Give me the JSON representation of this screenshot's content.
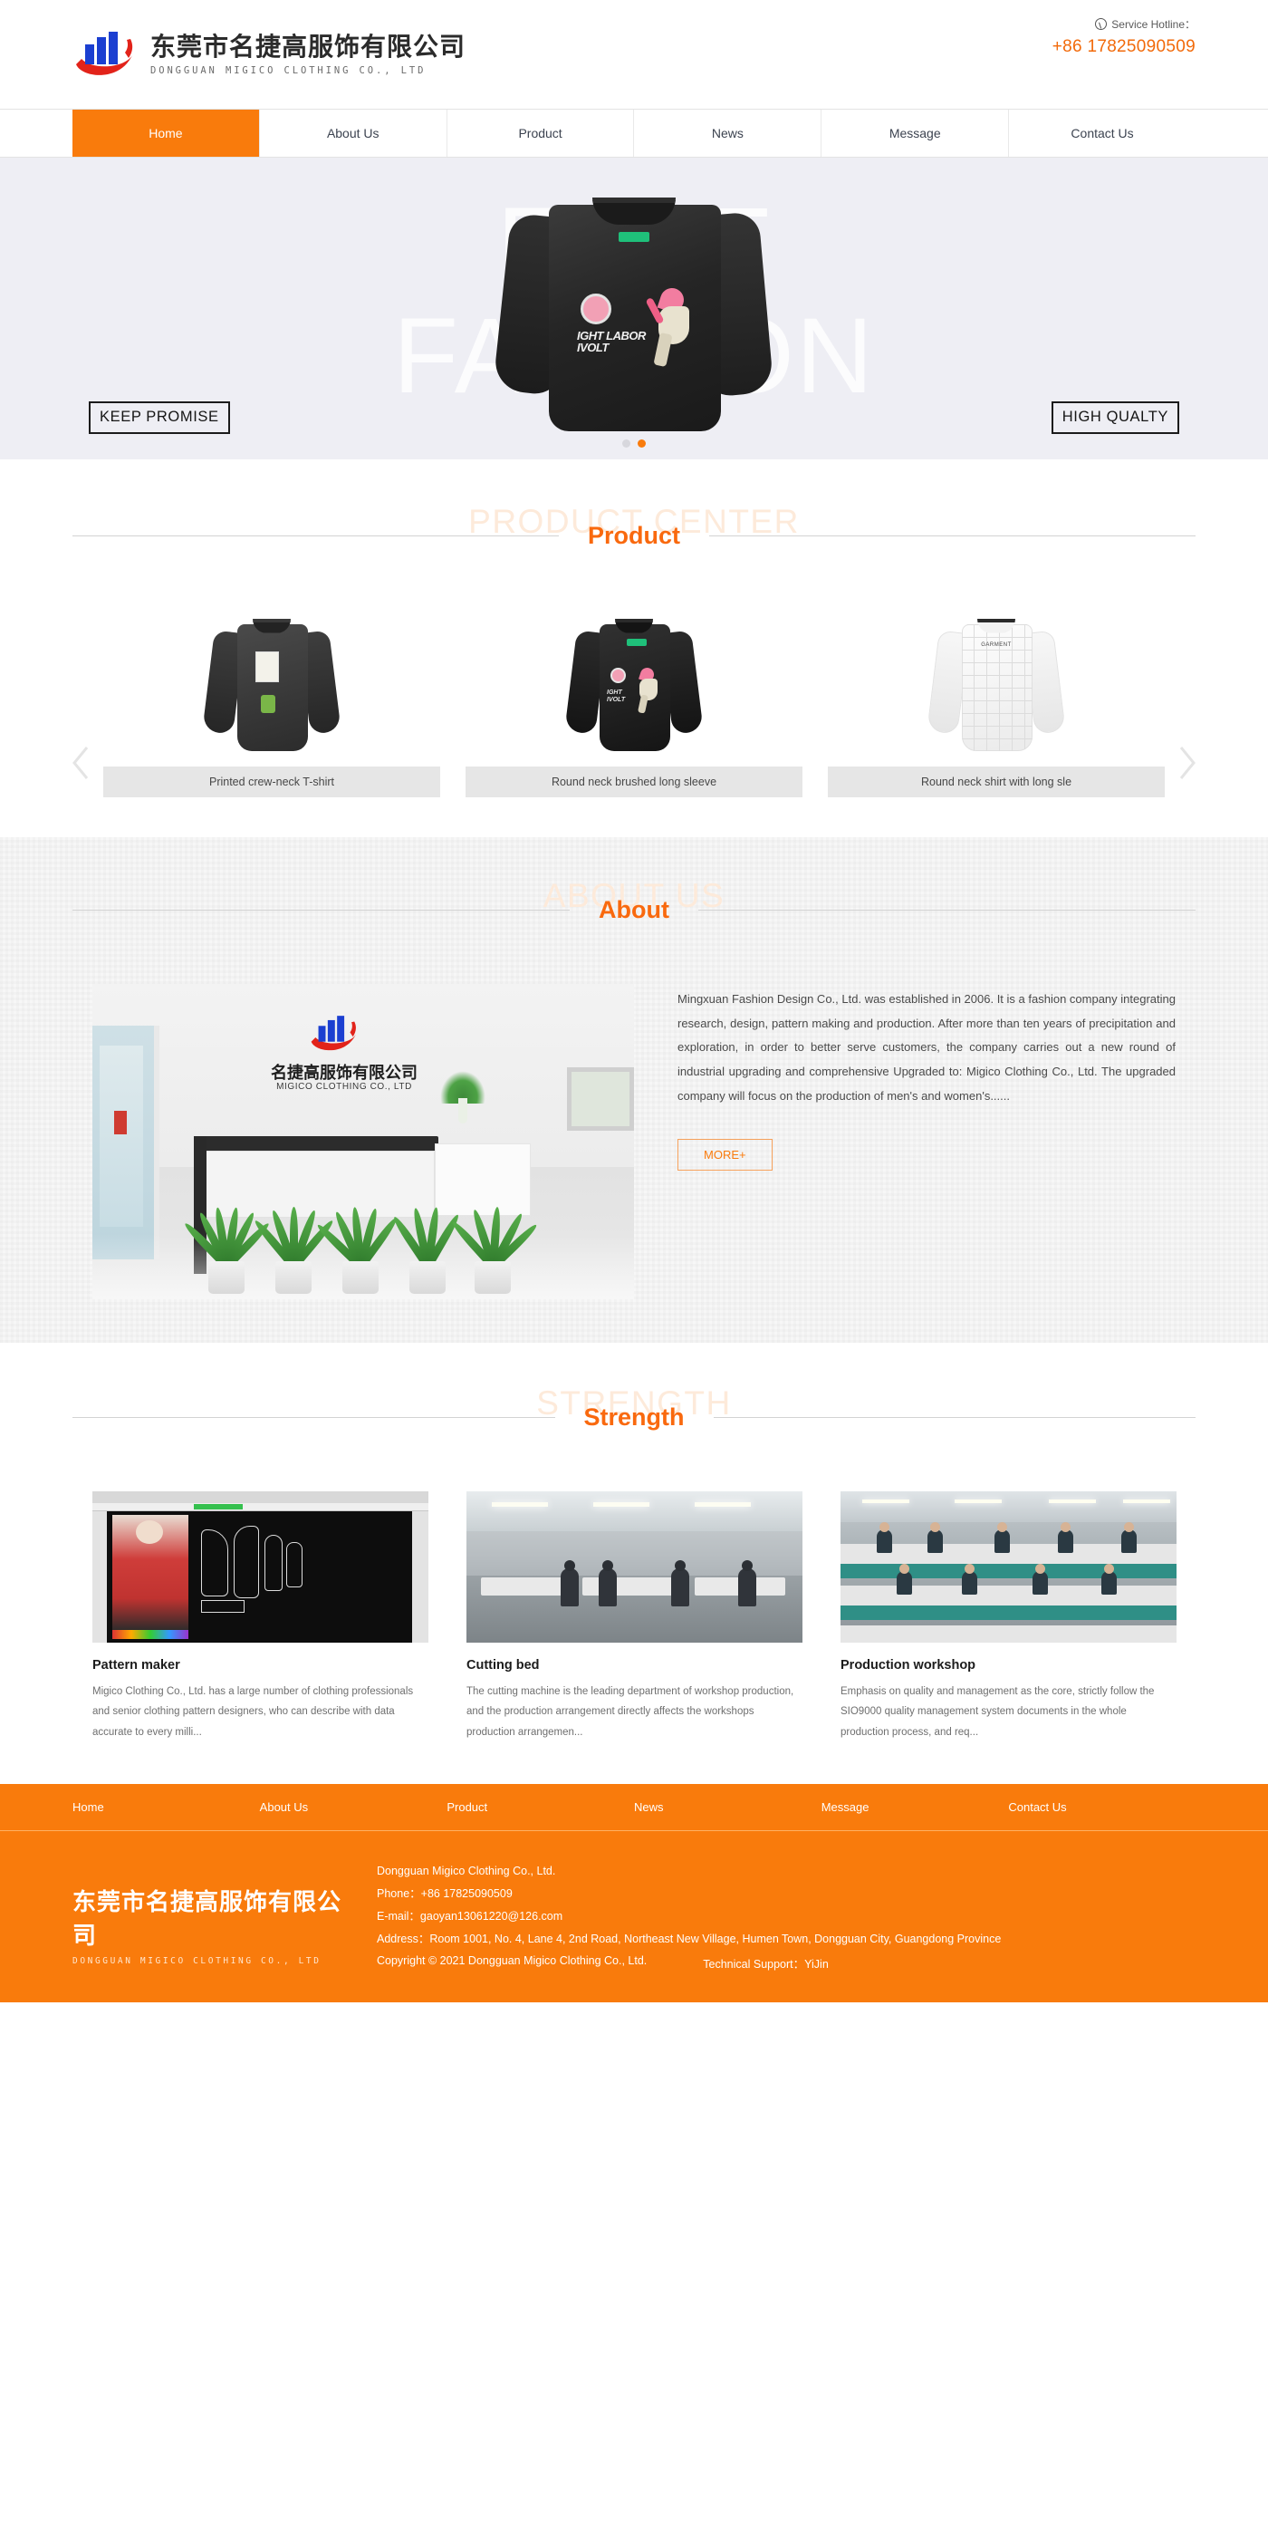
{
  "header": {
    "logo_cn": "东莞市名捷高服饰有限公司",
    "logo_en": "DONGGUAN MIGICO CLOTHING CO., LTD",
    "hotline_label": "Service Hotline：",
    "hotline_number": "+86 17825090509"
  },
  "nav": {
    "items": [
      {
        "label": "Home",
        "active": true
      },
      {
        "label": "About Us",
        "active": false
      },
      {
        "label": "Product",
        "active": false
      },
      {
        "label": "News",
        "active": false
      },
      {
        "label": "Message",
        "active": false
      },
      {
        "label": "Contact Us",
        "active": false
      }
    ]
  },
  "hero": {
    "word_top": "FAST",
    "word_bottom": "FASHION",
    "badge_left": "KEEP PROMISE",
    "badge_right": "HIGH QUALTY",
    "dots": 2,
    "active_dot": 1,
    "accent": "#f97b0c"
  },
  "product_section": {
    "ghost_title": "PRODUCT CENTER",
    "title": "Product",
    "prev_label": "‹",
    "next_label": "›",
    "items": [
      {
        "caption": "Printed crew-neck T-shirt"
      },
      {
        "caption": "Round neck brushed long sleeve"
      },
      {
        "caption": "Round neck shirt with long sle"
      }
    ]
  },
  "about_section": {
    "ghost_title": "ABOUT US",
    "title": "About",
    "photo_logo_cn": "名捷高服饰有限公司",
    "photo_logo_en": "MIGICO CLOTHING CO., LTD",
    "paragraph": "Mingxuan Fashion Design Co., Ltd. was established in 2006. It is a fashion company integrating research, design, pattern making and production. After more than ten years of precipitation and exploration, in order to better serve customers, the company carries out a new round of industrial upgrading and comprehensive Upgraded to: Migico Clothing Co., Ltd. The upgraded company will focus on the production of men's and women's......",
    "more_label": "MORE+"
  },
  "strength_section": {
    "ghost_title": "STRENGTH",
    "title": "Strength",
    "cards": [
      {
        "title": "Pattern maker",
        "desc": "Migico Clothing Co., Ltd. has a large number of clothing professionals and senior clothing pattern designers, who can describe with data accurate to every milli..."
      },
      {
        "title": "Cutting bed",
        "desc": "The cutting machine is the leading department of workshop production, and the production arrangement directly affects the workshops production arrangemen..."
      },
      {
        "title": "Production workshop",
        "desc": "Emphasis on quality and management as the core, strictly follow the SIO9000 quality management system documents in the whole production process, and req..."
      }
    ]
  },
  "footer": {
    "nav_items": [
      {
        "label": "Home"
      },
      {
        "label": "About Us"
      },
      {
        "label": "Product"
      },
      {
        "label": "News"
      },
      {
        "label": "Message"
      },
      {
        "label": "Contact Us"
      }
    ],
    "brand_cn": "东莞市名捷高服饰有限公司",
    "brand_en": "DONGGUAN MIGICO CLOTHING CO., LTD",
    "company": "Dongguan Migico Clothing Co., Ltd.",
    "phone": "Phone：+86 17825090509",
    "email": "E-mail：gaoyan13061220@126.com",
    "address": "Address：Room 1001, No. 4, Lane 4, 2nd Road, Northeast New Village, Humen Town, Dongguan City, Guangdong Province",
    "copyright": "Copyright © 2021    Dongguan Migico Clothing Co., Ltd.",
    "tech_support": "Technical Support：YiJin",
    "bg_color": "#f97b0c"
  }
}
